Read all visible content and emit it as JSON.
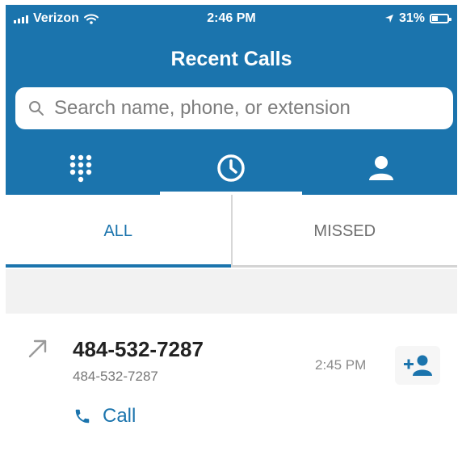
{
  "status_bar": {
    "carrier": "Verizon",
    "time": "2:46 PM",
    "battery": "31%",
    "battery_level": 0.31
  },
  "header": {
    "title": "Recent Calls"
  },
  "search": {
    "placeholder": "Search name, phone, or extension",
    "value": ""
  },
  "tabs": [
    {
      "icon": "dialpad-icon"
    },
    {
      "icon": "clock-icon",
      "active": true
    },
    {
      "icon": "person-icon"
    }
  ],
  "filters": {
    "all_label": "ALL",
    "missed_label": "MISSED",
    "selected": "ALL"
  },
  "calls": [
    {
      "direction_icon": "outgoing-arrow-icon",
      "number": "484-532-7287",
      "subtext": "484-532-7287",
      "time": "2:45 PM",
      "action_label": "Call"
    }
  ],
  "colors": {
    "header_bg": "#1b74ad",
    "accent": "#1b74ad",
    "divider": "#d4d4d4",
    "spacer_bg": "#f2f2f2"
  }
}
